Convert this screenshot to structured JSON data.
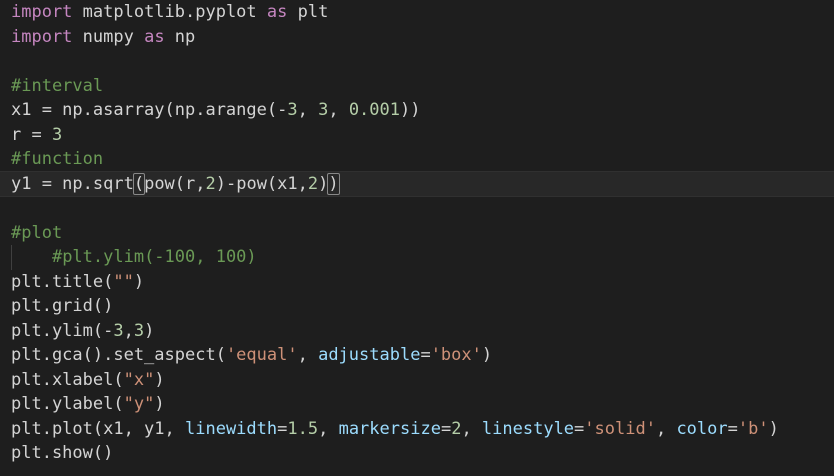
{
  "editor": {
    "lines": [
      [
        {
          "t": "import",
          "c": "kw"
        },
        {
          "t": " matplotlib.pyplot ",
          "c": "plain"
        },
        {
          "t": "as",
          "c": "kw"
        },
        {
          "t": " plt",
          "c": "plain"
        }
      ],
      [
        {
          "t": "import",
          "c": "kw"
        },
        {
          "t": " numpy ",
          "c": "plain"
        },
        {
          "t": "as",
          "c": "kw"
        },
        {
          "t": " np",
          "c": "plain"
        }
      ],
      [],
      [
        {
          "t": "#interval",
          "c": "cm"
        }
      ],
      [
        {
          "t": "x1 = np.asarray(np.arange(-",
          "c": "plain"
        },
        {
          "t": "3",
          "c": "num"
        },
        {
          "t": ", ",
          "c": "plain"
        },
        {
          "t": "3",
          "c": "num"
        },
        {
          "t": ", ",
          "c": "plain"
        },
        {
          "t": "0.001",
          "c": "num"
        },
        {
          "t": "))",
          "c": "plain"
        }
      ],
      [
        {
          "t": "r = ",
          "c": "plain"
        },
        {
          "t": "3",
          "c": "num"
        }
      ],
      [
        {
          "t": "#function",
          "c": "cm"
        }
      ],
      [
        {
          "t": "y1 = np.sqrt",
          "c": "plain"
        },
        {
          "t": "(",
          "c": "plain",
          "hl": true
        },
        {
          "t": "pow(r,",
          "c": "plain"
        },
        {
          "t": "2",
          "c": "num"
        },
        {
          "t": ")-pow(x1,",
          "c": "plain"
        },
        {
          "t": "2",
          "c": "num"
        },
        {
          "t": ")",
          "c": "plain"
        },
        {
          "t": ")",
          "c": "plain",
          "hl": true
        }
      ],
      [],
      [
        {
          "t": "#plot",
          "c": "cm"
        }
      ],
      [
        {
          "t": "    ",
          "c": "plain"
        },
        {
          "t": "#plt.ylim(-100, 100)",
          "c": "cm"
        }
      ],
      [
        {
          "t": "plt.title(",
          "c": "plain"
        },
        {
          "t": "\"\"",
          "c": "str"
        },
        {
          "t": ")",
          "c": "plain"
        }
      ],
      [
        {
          "t": "plt.grid()",
          "c": "plain"
        }
      ],
      [
        {
          "t": "plt.ylim(-",
          "c": "plain"
        },
        {
          "t": "3",
          "c": "num"
        },
        {
          "t": ",",
          "c": "plain"
        },
        {
          "t": "3",
          "c": "num"
        },
        {
          "t": ")",
          "c": "plain"
        }
      ],
      [
        {
          "t": "plt.gca().set_aspect(",
          "c": "plain"
        },
        {
          "t": "'equal'",
          "c": "str"
        },
        {
          "t": ", ",
          "c": "plain"
        },
        {
          "t": "adjustable",
          "c": "param"
        },
        {
          "t": "=",
          "c": "plain"
        },
        {
          "t": "'box'",
          "c": "str"
        },
        {
          "t": ")",
          "c": "plain"
        }
      ],
      [
        {
          "t": "plt.xlabel(",
          "c": "plain"
        },
        {
          "t": "\"x\"",
          "c": "str"
        },
        {
          "t": ")",
          "c": "plain"
        }
      ],
      [
        {
          "t": "plt.ylabel(",
          "c": "plain"
        },
        {
          "t": "\"y\"",
          "c": "str"
        },
        {
          "t": ")",
          "c": "plain"
        }
      ],
      [
        {
          "t": "plt.plot(x1, y1, ",
          "c": "plain"
        },
        {
          "t": "linewidth",
          "c": "param"
        },
        {
          "t": "=",
          "c": "plain"
        },
        {
          "t": "1.5",
          "c": "num"
        },
        {
          "t": ", ",
          "c": "plain"
        },
        {
          "t": "markersize",
          "c": "param"
        },
        {
          "t": "=",
          "c": "plain"
        },
        {
          "t": "2",
          "c": "num"
        },
        {
          "t": ", ",
          "c": "plain"
        },
        {
          "t": "linestyle",
          "c": "param"
        },
        {
          "t": "=",
          "c": "plain"
        },
        {
          "t": "'solid'",
          "c": "str"
        },
        {
          "t": ", ",
          "c": "plain"
        },
        {
          "t": "color",
          "c": "param"
        },
        {
          "t": "=",
          "c": "plain"
        },
        {
          "t": "'b'",
          "c": "str"
        },
        {
          "t": ")",
          "c": "plain"
        }
      ],
      [
        {
          "t": "plt.show()",
          "c": "plain"
        }
      ]
    ],
    "current_line": 7,
    "indented_line": 10
  },
  "colors": {
    "background": "#1e1e1e",
    "keyword": "#c586c0",
    "comment": "#6a9955",
    "number": "#b5cea8",
    "string": "#ce9178",
    "parameter": "#9cdcfe",
    "text": "#d4d4d4"
  }
}
